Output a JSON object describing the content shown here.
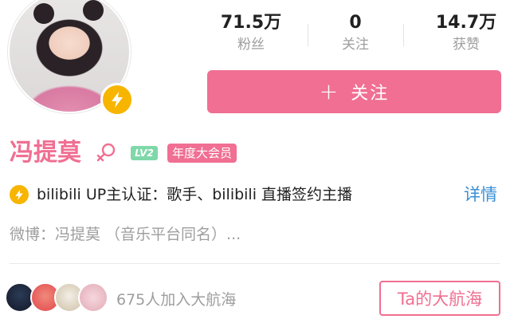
{
  "profile": {
    "name": "冯提莫",
    "level": "LV2",
    "vip": "年度大会员"
  },
  "stats": [
    {
      "value": "71.5万",
      "label": "粉丝"
    },
    {
      "value": "0",
      "label": "关注"
    },
    {
      "value": "14.7万",
      "label": "获赞"
    }
  ],
  "follow_button": {
    "icon": "+",
    "label": "关注"
  },
  "verification": {
    "text": "bilibili UP主认证：歌手、bilibili 直播签约主播",
    "detail_link": "详情"
  },
  "weibo": "微博：冯提莫 （音乐平台同名）...",
  "fleet": {
    "count_text": "675人加入大航海",
    "button_label": "Ta的大航海"
  },
  "colors": {
    "accent": "#f06f92",
    "badge_yellow": "#f7b500",
    "link_blue": "#3a8fd6",
    "level_green": "#7fd8a8"
  },
  "icons": [
    "lightning-icon",
    "female-icon",
    "plus-icon"
  ]
}
